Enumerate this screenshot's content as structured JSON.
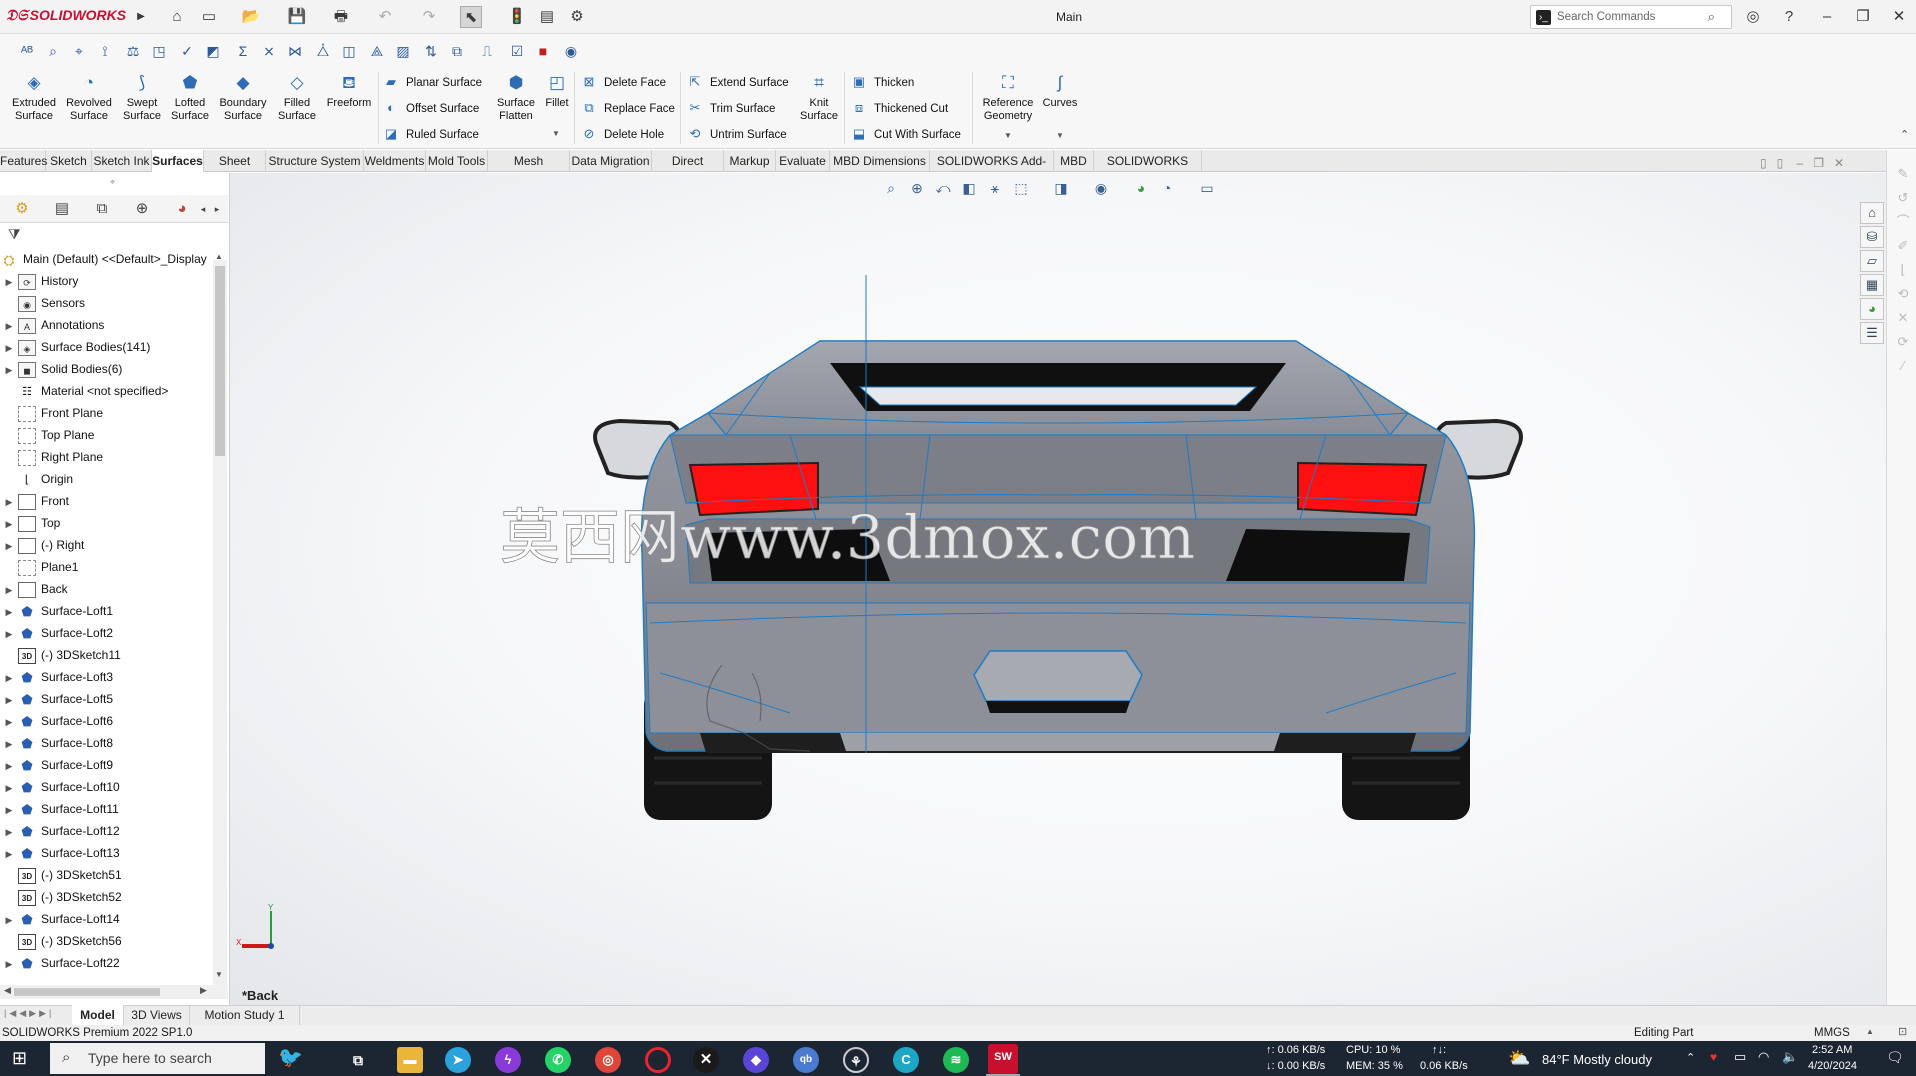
{
  "app": {
    "brand": "SOLIDWORKS",
    "title": "Main"
  },
  "search": {
    "placeholder": "Search Commands"
  },
  "ribbon": {
    "big": [
      {
        "icon": "extruded-surface-icon",
        "line1": "Extruded",
        "line2": "Surface"
      },
      {
        "icon": "revolved-surface-icon",
        "line1": "Revolved",
        "line2": "Surface"
      },
      {
        "icon": "swept-surface-icon",
        "line1": "Swept",
        "line2": "Surface"
      },
      {
        "icon": "lofted-surface-icon",
        "line1": "Lofted",
        "line2": "Surface"
      },
      {
        "icon": "boundary-surface-icon",
        "line1": "Boundary",
        "line2": "Surface"
      },
      {
        "icon": "filled-surface-icon",
        "line1": "Filled",
        "line2": "Surface"
      },
      {
        "icon": "freeform-icon",
        "line1": "Freeform",
        "line2": ""
      }
    ],
    "col1": [
      "Planar Surface",
      "Offset Surface",
      "Ruled Surface"
    ],
    "flatten": {
      "line1": "Surface",
      "line2": "Flatten"
    },
    "fillet": "Fillet",
    "col2": [
      "Delete Face",
      "Replace Face",
      "Delete Hole"
    ],
    "col3": [
      "Extend Surface",
      "Trim Surface",
      "Untrim Surface"
    ],
    "knit": {
      "line1": "Knit",
      "line2": "Surface"
    },
    "col4": [
      "Thicken",
      "Thickened Cut",
      "Cut With Surface"
    ],
    "refgeom": {
      "line1": "Reference",
      "line2": "Geometry"
    },
    "curves": "Curves"
  },
  "tabs": [
    "Features",
    "Sketch",
    "Sketch Ink",
    "Surfaces",
    "Sheet Metal",
    "Structure System",
    "Weldments",
    "Mold Tools",
    "Mesh Modeling",
    "Data Migration",
    "Direct Editing",
    "Markup",
    "Evaluate",
    "MBD Dimensions",
    "SOLIDWORKS Add-Ins",
    "MBD",
    "SOLIDWORKS CAM"
  ],
  "active_tab": "Surfaces",
  "tree": {
    "root": "Main (Default) <<Default>_Display",
    "items": [
      {
        "label": "History",
        "icon": "history-icon",
        "expand": true
      },
      {
        "label": "Sensors",
        "icon": "sensors-icon",
        "expand": false
      },
      {
        "label": "Annotations",
        "icon": "annotations-icon",
        "expand": true
      },
      {
        "label": "Surface Bodies(141)",
        "icon": "surface-bodies-icon",
        "expand": true
      },
      {
        "label": "Solid Bodies(6)",
        "icon": "solid-bodies-icon",
        "expand": true
      },
      {
        "label": "Material <not specified>",
        "icon": "material-icon",
        "expand": false
      },
      {
        "label": "Front Plane",
        "icon": "plane-icon",
        "expand": false
      },
      {
        "label": "Top Plane",
        "icon": "plane-icon",
        "expand": false
      },
      {
        "label": "Right Plane",
        "icon": "plane-icon",
        "expand": false
      },
      {
        "label": "Origin",
        "icon": "origin-icon",
        "expand": false
      },
      {
        "label": "Front",
        "icon": "sketch-icon",
        "expand": true
      },
      {
        "label": "Top",
        "icon": "sketch-icon",
        "expand": true
      },
      {
        "label": "(-) Right",
        "icon": "sketch-icon",
        "expand": true
      },
      {
        "label": "Plane1",
        "icon": "plane-icon",
        "expand": false
      },
      {
        "label": "Back",
        "icon": "sketch-icon",
        "expand": true
      },
      {
        "label": "Surface-Loft1",
        "icon": "loft-icon",
        "expand": true
      },
      {
        "label": "Surface-Loft2",
        "icon": "loft-icon",
        "expand": true
      },
      {
        "label": "(-) 3DSketch11",
        "icon": "3dsketch-icon",
        "expand": false
      },
      {
        "label": "Surface-Loft3",
        "icon": "loft-icon",
        "expand": true
      },
      {
        "label": "Surface-Loft5",
        "icon": "loft-icon",
        "expand": true
      },
      {
        "label": "Surface-Loft6",
        "icon": "loft-icon",
        "expand": true
      },
      {
        "label": "Surface-Loft8",
        "icon": "loft-icon",
        "expand": true
      },
      {
        "label": "Surface-Loft9",
        "icon": "loft-icon",
        "expand": true
      },
      {
        "label": "Surface-Loft10",
        "icon": "loft-icon",
        "expand": true
      },
      {
        "label": "Surface-Loft11",
        "icon": "loft-icon",
        "expand": true
      },
      {
        "label": "Surface-Loft12",
        "icon": "loft-icon",
        "expand": true
      },
      {
        "label": "Surface-Loft13",
        "icon": "loft-icon",
        "expand": true
      },
      {
        "label": "(-) 3DSketch51",
        "icon": "3dsketch-icon",
        "expand": false
      },
      {
        "label": "(-) 3DSketch52",
        "icon": "3dsketch-icon",
        "expand": false
      },
      {
        "label": "Surface-Loft14",
        "icon": "loft-icon",
        "expand": true
      },
      {
        "label": "(-) 3DSketch56",
        "icon": "3dsketch-icon",
        "expand": false
      },
      {
        "label": "Surface-Loft22",
        "icon": "loft-icon",
        "expand": true
      }
    ]
  },
  "viewport": {
    "view_label": "*Back",
    "watermark": "莫西网www.3dmox.com"
  },
  "bottom_tabs": [
    "Model",
    "3D Views",
    "Motion Study 1"
  ],
  "active_bottom_tab": "Model",
  "status": {
    "left": "SOLIDWORKS Premium 2022 SP1.0",
    "mode": "Editing Part",
    "units": "MMGS"
  },
  "taskbar": {
    "search_placeholder": "Type here to search",
    "net_up": "↑: 0.06 KB/s",
    "net_down": "↓: 0.00 KB/s",
    "cpu": "CPU: 10 %",
    "mem": "MEM: 35 %",
    "disk_arrow": "↑↓:",
    "disk": "0.06 KB/s",
    "weather": "84°F  Mostly cloudy",
    "time": "2:52 AM",
    "date": "4/20/2024"
  },
  "colors": {
    "accent": "#2d6db5",
    "taillight": "#ff1010",
    "car_body": "#8c8e98",
    "edge": "#1f7fc8"
  }
}
